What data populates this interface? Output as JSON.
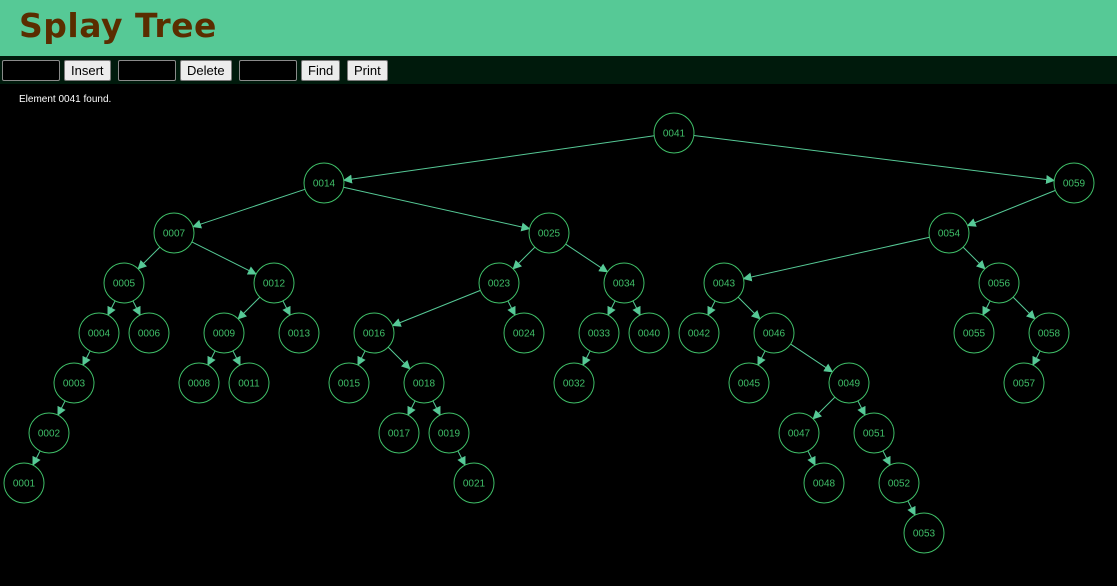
{
  "header": {
    "title": "Splay Tree"
  },
  "toolbar": {
    "insert_value": "",
    "insert_label": "Insert",
    "delete_value": "",
    "delete_label": "Delete",
    "find_value": "",
    "find_label": "Find",
    "print_label": "Print"
  },
  "status": {
    "message": "Element 0041 found."
  },
  "colors": {
    "header_bg": "#56c996",
    "title": "#5a2d00",
    "toolbar_bg": "#001a0c",
    "canvas_bg": "#000000",
    "node_stroke": "#3fbf68",
    "node_text": "#3fbf68",
    "edge": "#56c996"
  },
  "tree": {
    "root": "0041",
    "nodes": [
      {
        "id": "0041",
        "left": "0014",
        "right": "0059"
      },
      {
        "id": "0014",
        "left": "0007",
        "right": "0025"
      },
      {
        "id": "0059",
        "left": "0054",
        "right": null
      },
      {
        "id": "0007",
        "left": "0005",
        "right": "0012"
      },
      {
        "id": "0025",
        "left": "0023",
        "right": "0034"
      },
      {
        "id": "0054",
        "left": "0043",
        "right": "0056"
      },
      {
        "id": "0005",
        "left": "0004",
        "right": "0006"
      },
      {
        "id": "0012",
        "left": "0009",
        "right": "0013"
      },
      {
        "id": "0023",
        "left": "0016",
        "right": "0024"
      },
      {
        "id": "0034",
        "left": "0033",
        "right": "0040"
      },
      {
        "id": "0043",
        "left": "0042",
        "right": "0046"
      },
      {
        "id": "0056",
        "left": "0055",
        "right": "0058"
      },
      {
        "id": "0004",
        "left": "0003",
        "right": null
      },
      {
        "id": "0006",
        "left": null,
        "right": null
      },
      {
        "id": "0009",
        "left": "0008",
        "right": "0011"
      },
      {
        "id": "0013",
        "left": null,
        "right": null
      },
      {
        "id": "0016",
        "left": "0015",
        "right": "0018"
      },
      {
        "id": "0024",
        "left": null,
        "right": null
      },
      {
        "id": "0033",
        "left": "0032",
        "right": null
      },
      {
        "id": "0040",
        "left": null,
        "right": null
      },
      {
        "id": "0042",
        "left": null,
        "right": null
      },
      {
        "id": "0046",
        "left": "0045",
        "right": "0049"
      },
      {
        "id": "0055",
        "left": null,
        "right": null
      },
      {
        "id": "0058",
        "left": "0057",
        "right": null
      },
      {
        "id": "0003",
        "left": "0002",
        "right": null
      },
      {
        "id": "0008",
        "left": null,
        "right": null
      },
      {
        "id": "0011",
        "left": null,
        "right": null
      },
      {
        "id": "0015",
        "left": null,
        "right": null
      },
      {
        "id": "0018",
        "left": "0017",
        "right": "0019"
      },
      {
        "id": "0032",
        "left": null,
        "right": null
      },
      {
        "id": "0045",
        "left": null,
        "right": null
      },
      {
        "id": "0049",
        "left": "0047",
        "right": "0051"
      },
      {
        "id": "0057",
        "left": null,
        "right": null
      },
      {
        "id": "0002",
        "left": "0001",
        "right": null
      },
      {
        "id": "0017",
        "left": null,
        "right": null
      },
      {
        "id": "0019",
        "left": null,
        "right": "0021"
      },
      {
        "id": "0047",
        "left": null,
        "right": "0048"
      },
      {
        "id": "0051",
        "left": null,
        "right": "0052"
      },
      {
        "id": "0001",
        "left": null,
        "right": null
      },
      {
        "id": "0021",
        "left": null,
        "right": null
      },
      {
        "id": "0048",
        "left": null,
        "right": null
      },
      {
        "id": "0052",
        "left": null,
        "right": "0053"
      },
      {
        "id": "0053",
        "left": null,
        "right": null
      }
    ]
  }
}
